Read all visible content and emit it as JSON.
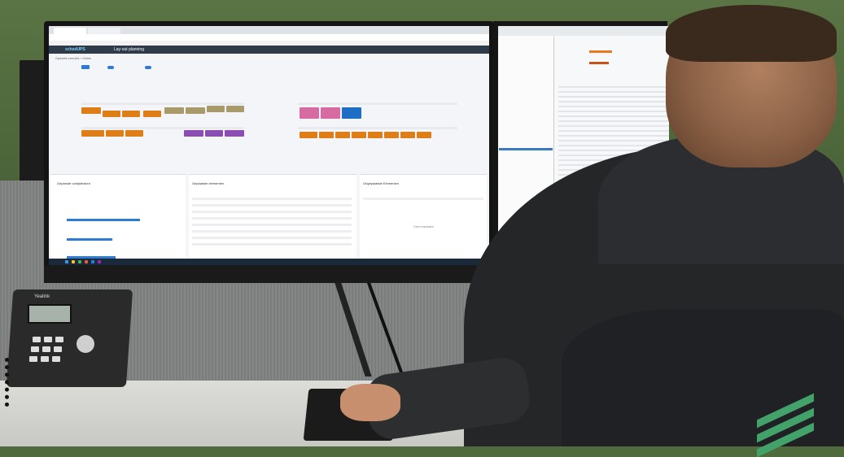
{
  "screen1": {
    "app_logo": "schedUPS",
    "page_title": "Lay-out planning",
    "breadcrumb": "Opdracht overzicht > Orders",
    "panel_left_title": "Geplande oorlijsthaken",
    "panel_mid_title": "Geplaatste elementen",
    "panel_right_title": "Ongeplaatste Elementen",
    "empty_text": "Geen resultaten",
    "colors": {
      "orange": "#de7e18",
      "tan": "#a99a6b",
      "purple": "#8a4db1",
      "pink": "#d76aa0",
      "blue": "#1d6ec4",
      "appbar": "#2f3b49"
    }
  },
  "phone_brand": "Yealink"
}
